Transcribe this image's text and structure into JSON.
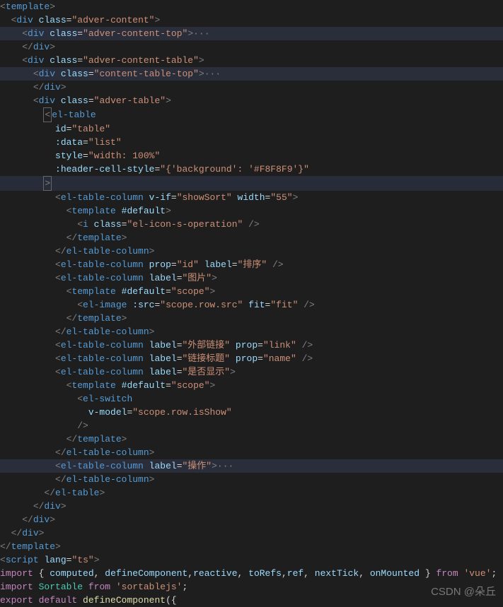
{
  "watermark": "CSDN @朵丘",
  "code": {
    "l1": {
      "open": "<",
      "tag": "template",
      "close": ">"
    },
    "l2": {
      "open": "<",
      "tag": "div",
      "sp": " ",
      "attr": "class",
      "eq": "=",
      "val": "\"adver-content\"",
      "close": ">"
    },
    "l3": {
      "open": "<",
      "tag": "div",
      "sp": " ",
      "attr": "class",
      "eq": "=",
      "val": "\"adver-content-top\"",
      "close": ">",
      "dots": "···"
    },
    "l4": {
      "open": "</",
      "tag": "div",
      "close": ">"
    },
    "l5": {
      "open": "<",
      "tag": "div",
      "sp": " ",
      "attr": "class",
      "eq": "=",
      "val": "\"adver-content-table\"",
      "close": ">"
    },
    "l6": {
      "open": "<",
      "tag": "div",
      "sp": " ",
      "attr": "class",
      "eq": "=",
      "val": "\"content-table-top\"",
      "close": ">",
      "dots": "···"
    },
    "l7": {
      "open": "</",
      "tag": "div",
      "close": ">"
    },
    "l8": {
      "open": "<",
      "tag": "div",
      "sp": " ",
      "attr": "class",
      "eq": "=",
      "val": "\"adver-table\"",
      "close": ">"
    },
    "l9": {
      "open": "<",
      "tag": "el-table"
    },
    "l10": {
      "attr": "id",
      "eq": "=",
      "val": "\"table\""
    },
    "l11": {
      "attr": ":data",
      "eq": "=",
      "val": "\"list\""
    },
    "l12": {
      "attr": "style",
      "eq": "=",
      "val": "\"width: 100%\""
    },
    "l13": {
      "attr": ":header-cell-style",
      "eq": "=",
      "val": "\"{'background': '#F8F8F9'}\""
    },
    "l14": {
      "close": ">"
    },
    "l15": {
      "open": "<",
      "tag": "el-table-column",
      "sp": " ",
      "a1": "v-if",
      "eq1": "=",
      "v1": "\"showSort\"",
      "sp2": " ",
      "a2": "width",
      "eq2": "=",
      "v2": "\"55\"",
      "close": ">"
    },
    "l16": {
      "open": "<",
      "tag": "template",
      "sp": " ",
      "attr": "#default",
      "close": ">"
    },
    "l17": {
      "open": "<",
      "tag": "i",
      "sp": " ",
      "attr": "class",
      "eq": "=",
      "val": "\"el-icon-s-operation\"",
      "close": " />"
    },
    "l18": {
      "open": "</",
      "tag": "template",
      "close": ">"
    },
    "l19": {
      "open": "</",
      "tag": "el-table-column",
      "close": ">"
    },
    "l20": {
      "open": "<",
      "tag": "el-table-column",
      "sp": " ",
      "a1": "prop",
      "eq1": "=",
      "v1": "\"id\"",
      "sp2": " ",
      "a2": "label",
      "eq2": "=",
      "v2": "\"排序\"",
      "close": " />"
    },
    "l21": {
      "open": "<",
      "tag": "el-table-column",
      "sp": " ",
      "a1": "label",
      "eq1": "=",
      "v1": "\"图片\"",
      "close": ">"
    },
    "l22": {
      "open": "<",
      "tag": "template",
      "sp": " ",
      "attr": "#default",
      "eq": "=",
      "val": "\"scope\"",
      "close": ">"
    },
    "l23": {
      "open": "<",
      "tag": "el-image",
      "sp": " ",
      "a1": ":src",
      "eq1": "=",
      "v1": "\"scope.row.src\"",
      "sp2": " ",
      "a2": "fit",
      "eq2": "=",
      "v2": "\"fit\"",
      "close": " />"
    },
    "l24": {
      "open": "</",
      "tag": "template",
      "close": ">"
    },
    "l25": {
      "open": "</",
      "tag": "el-table-column",
      "close": ">"
    },
    "l26": {
      "open": "<",
      "tag": "el-table-column",
      "sp": " ",
      "a1": "label",
      "eq1": "=",
      "v1": "\"外部链接\"",
      "sp2": " ",
      "a2": "prop",
      "eq2": "=",
      "v2": "\"link\"",
      "close": " />"
    },
    "l27": {
      "open": "<",
      "tag": "el-table-column",
      "sp": " ",
      "a1": "label",
      "eq1": "=",
      "v1": "\"链接标题\"",
      "sp2": " ",
      "a2": "prop",
      "eq2": "=",
      "v2": "\"name\"",
      "close": " />"
    },
    "l28": {
      "open": "<",
      "tag": "el-table-column",
      "sp": " ",
      "a1": "label",
      "eq1": "=",
      "v1": "\"是否显示\"",
      "close": ">"
    },
    "l29": {
      "open": "<",
      "tag": "template",
      "sp": " ",
      "attr": "#default",
      "eq": "=",
      "val": "\"scope\"",
      "close": ">"
    },
    "l30": {
      "open": "<",
      "tag": "el-switch"
    },
    "l31": {
      "attr": "v-model",
      "eq": "=",
      "val": "\"scope.row.isShow\""
    },
    "l32": {
      "close": "/>"
    },
    "l33": {
      "open": "</",
      "tag": "template",
      "close": ">"
    },
    "l34": {
      "open": "</",
      "tag": "el-table-column",
      "close": ">"
    },
    "l35": {
      "open": "<",
      "tag": "el-table-column",
      "sp": " ",
      "a1": "label",
      "eq1": "=",
      "v1": "\"操作\"",
      "close": ">",
      "dots": "···"
    },
    "l36": {
      "open": "</",
      "tag": "el-table-column",
      "close": ">"
    },
    "l37": {
      "open": "</",
      "tag": "el-table",
      "close": ">"
    },
    "l38": {
      "open": "</",
      "tag": "div",
      "close": ">"
    },
    "l39": {
      "open": "</",
      "tag": "div",
      "close": ">"
    },
    "l40": {
      "open": "</",
      "tag": "div",
      "close": ">"
    },
    "l41": {
      "open": "</",
      "tag": "template",
      "close": ">"
    },
    "l42": {
      "open": "<",
      "tag": "script",
      "sp": " ",
      "attr": "lang",
      "eq": "=",
      "val": "\"ts\"",
      "close": ">"
    },
    "l43": {
      "kw": "import",
      "sp": " ",
      "br1": "{ ",
      "i1": "computed",
      "c1": ", ",
      "i2": "defineComponent",
      "c2": ",",
      "i3": "reactive",
      "c3": ", ",
      "i4": "toRefs",
      "c4": ",",
      "i5": "ref",
      "c5": ", ",
      "i6": "nextTick",
      "c6": ", ",
      "i7": "onMounted",
      "br2": " }",
      "kw2": " from ",
      "val": "'vue'",
      "semi": ";"
    },
    "l44": {
      "kw": "import",
      "sp": " ",
      "var": "Sortable",
      "kw2": " from ",
      "val": "'sortablejs'",
      "semi": ";"
    },
    "l45": {
      "kw": "export",
      "kw2": " default",
      "sp": " ",
      "fn": "defineComponent",
      "par": "({"
    }
  }
}
